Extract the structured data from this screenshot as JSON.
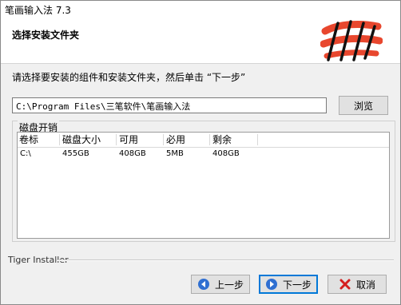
{
  "window": {
    "title": "笔画输入法 7.3"
  },
  "header": {
    "title": "选择安装文件夹"
  },
  "instruction": "请选择要安装的组件和安装文件夹，然后单击 “下一步”",
  "path": {
    "value": "C:\\Program Files\\三笔软件\\笔画输入法"
  },
  "browse_label": "浏览",
  "disk_group": {
    "label": "磁盘开销",
    "columns": [
      "卷标",
      "磁盘大小",
      "可用",
      "必用",
      "剩余"
    ],
    "rows": [
      [
        "C:\\",
        "455GB",
        "408GB",
        "5MB",
        "408GB"
      ]
    ]
  },
  "footer": {
    "brand": "Tiger Installer"
  },
  "buttons": {
    "back": "上一步",
    "next": "下一步",
    "cancel": "取消"
  },
  "colors": {
    "logo_red": "#e8472e",
    "logo_black": "#111111",
    "focus": "#0078d7",
    "arrow_blue": "#2f6fd1",
    "cancel_red": "#d41e1e"
  }
}
